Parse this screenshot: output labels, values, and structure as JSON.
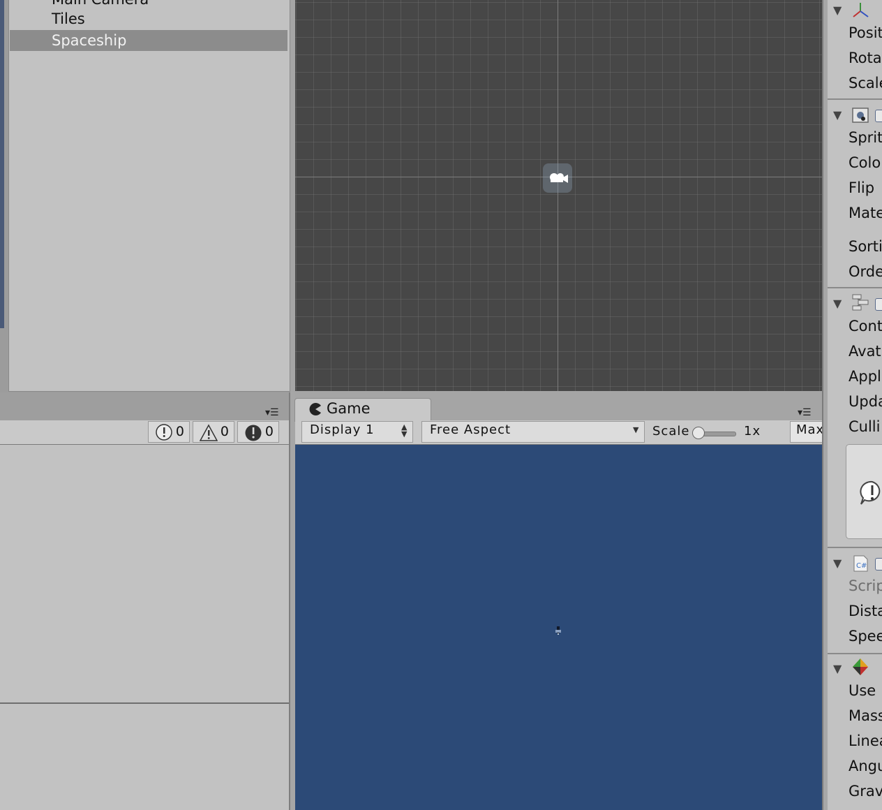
{
  "hierarchy": {
    "items": [
      "Main Camera",
      "Tiles",
      "Spaceship"
    ],
    "selected": "Spaceship"
  },
  "console": {
    "info_count": "0",
    "warning_count": "0",
    "error_count": "0",
    "menu_icon": "panel-menu-icon"
  },
  "game": {
    "tab_label": "Game",
    "display": "Display 1",
    "aspect": "Free Aspect",
    "scale_label": "Scale",
    "scale_value": "1x",
    "max_label": "Max",
    "background_color": "#2c4a77"
  },
  "inspector": {
    "transform": [
      "Posit",
      "Rota",
      "Scale"
    ],
    "sprite_renderer": [
      "Sprit",
      "Colo",
      "Flip",
      "Mate",
      "Sorti",
      "Orde"
    ],
    "animator": [
      "Cont",
      "Avat",
      "Appl",
      "Upda",
      "Culli"
    ],
    "script": [
      "Scrip",
      "Dista",
      "Spee"
    ],
    "rigidbody": [
      "Use",
      "Mass",
      "Linea",
      "Angu",
      "Grav"
    ]
  },
  "colors": {
    "scene_bg": "#474747",
    "panel_bg": "#c2c2c2",
    "selection": "#8c8c8c"
  }
}
